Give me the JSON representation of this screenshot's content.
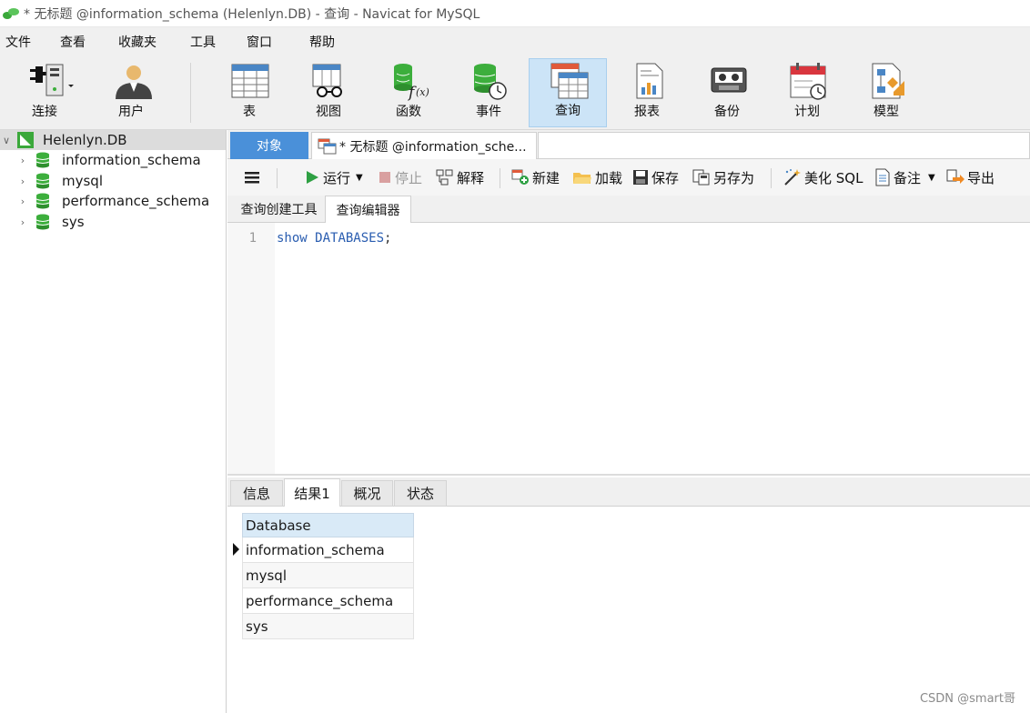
{
  "window": {
    "title": "* 无标题 @information_schema (Helenlyn.DB) - 查询 - Navicat for MySQL"
  },
  "menu": {
    "items": [
      "文件",
      "查看",
      "收藏夹",
      "工具",
      "窗口",
      "帮助"
    ]
  },
  "toolbar": {
    "buttons": [
      {
        "label": "连接",
        "icon": "plug-connect-icon"
      },
      {
        "label": "用户",
        "icon": "user-icon"
      },
      {
        "label": "表",
        "icon": "table-icon"
      },
      {
        "label": "视图",
        "icon": "view-glasses-icon"
      },
      {
        "label": "函数",
        "icon": "function-icon"
      },
      {
        "label": "事件",
        "icon": "event-clock-icon"
      },
      {
        "label": "查询",
        "icon": "query-icon",
        "active": true
      },
      {
        "label": "报表",
        "icon": "report-icon"
      },
      {
        "label": "备份",
        "icon": "backup-tape-icon"
      },
      {
        "label": "计划",
        "icon": "schedule-calendar-icon"
      },
      {
        "label": "模型",
        "icon": "model-icon"
      }
    ]
  },
  "sidebar": {
    "connection": "Helenlyn.DB",
    "databases": [
      "information_schema",
      "mysql",
      "performance_schema",
      "sys"
    ]
  },
  "tabs": {
    "objects": "对象",
    "query": "* 无标题 @information_sche..."
  },
  "query_toolbar": {
    "run": "运行",
    "stop": "停止",
    "explain": "解释",
    "new": "新建",
    "load": "加载",
    "save": "保存",
    "save_as": "另存为",
    "beautify": "美化 SQL",
    "comment": "备注",
    "export": "导出"
  },
  "subtabs": {
    "builder": "查询创建工具",
    "editor": "查询编辑器"
  },
  "editor": {
    "line_number": "1",
    "keyword": "show",
    "object": "DATABASES",
    "terminator": ";"
  },
  "result_tabs": [
    "信息",
    "结果1",
    "概况",
    "状态"
  ],
  "result_grid": {
    "columns": [
      "Database"
    ],
    "rows": [
      "information_schema",
      "mysql",
      "performance_schema",
      "sys"
    ]
  },
  "watermark": "CSDN @smart哥",
  "colors": {
    "accent": "#4a90d9",
    "active_toolbar": "#cce4f7",
    "grid_header": "#d9eaf7",
    "db_icon": "#3cae3c",
    "run_icon": "#2ea043"
  }
}
